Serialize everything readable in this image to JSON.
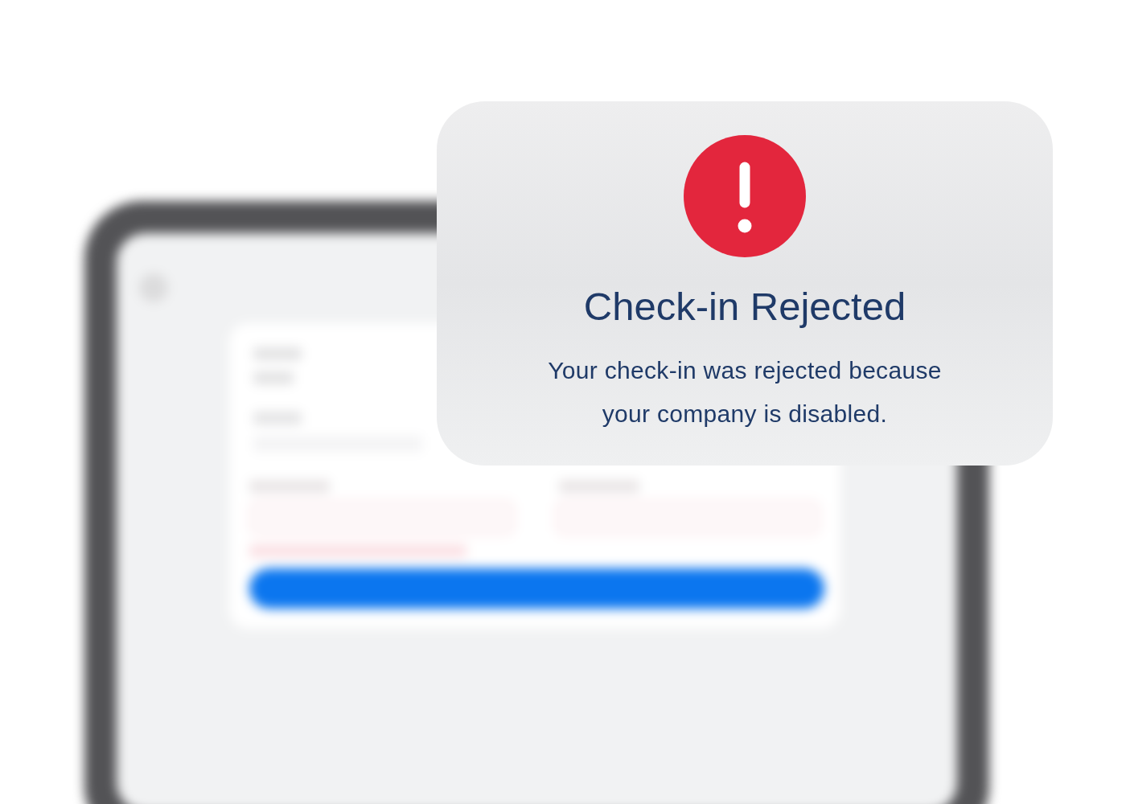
{
  "alert": {
    "title": "Check-in Rejected",
    "message": "Your check-in was rejected because your company is disabled."
  }
}
